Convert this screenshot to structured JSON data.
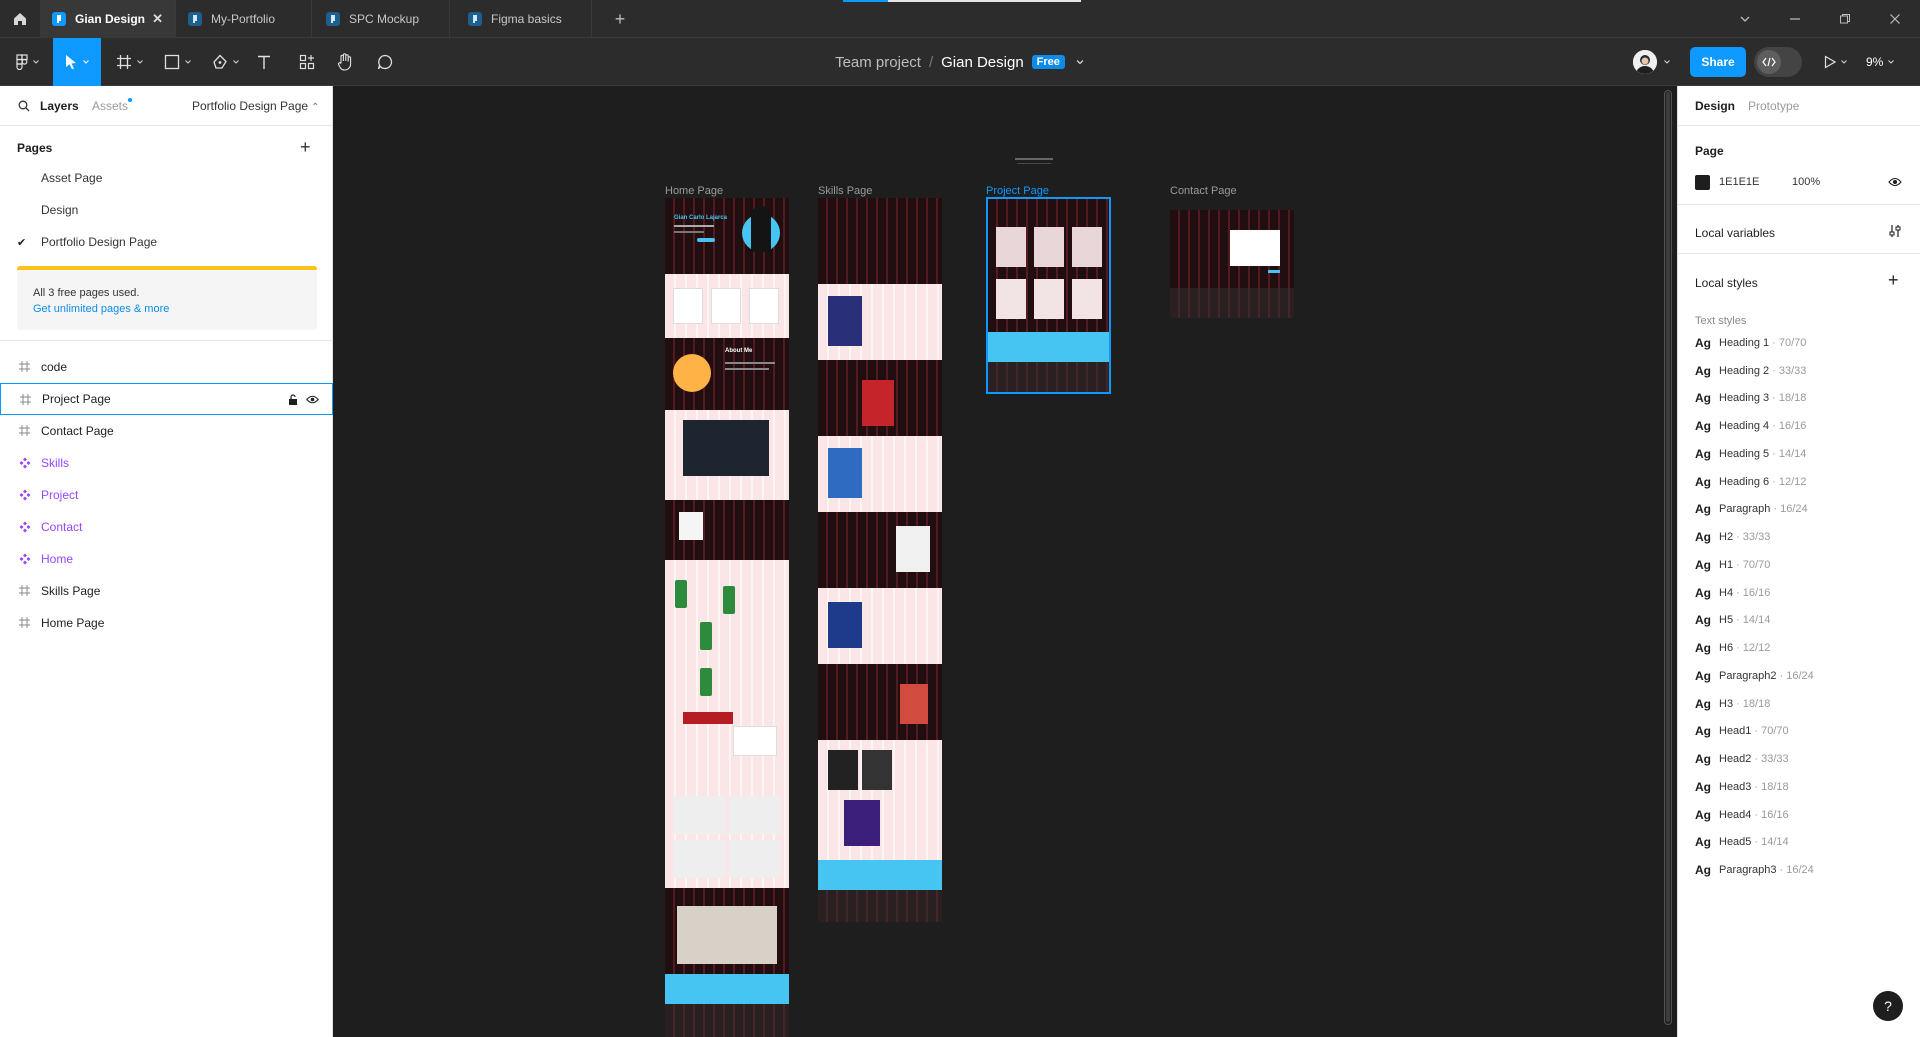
{
  "titlebar": {
    "tabs": [
      {
        "label": "Gian Design",
        "active": true
      },
      {
        "label": "My-Portfolio",
        "active": false
      },
      {
        "label": "SPC Mockup",
        "active": false
      },
      {
        "label": "Figma basics",
        "active": false
      }
    ],
    "close_glyph": "✕",
    "add_glyph": "+"
  },
  "toolbar": {
    "project": "Team project",
    "separator": "/",
    "file": "Gian Design",
    "plan_badge": "Free",
    "share_label": "Share",
    "zoom": "9%"
  },
  "left_panel": {
    "tab_layers": "Layers",
    "tab_assets": "Assets",
    "current_page": "Portfolio Design Page",
    "pages_header": "Pages",
    "add_glyph": "+",
    "check_glyph": "✔",
    "pages": [
      {
        "name": "Asset Page",
        "current": false
      },
      {
        "name": "Design",
        "current": false
      },
      {
        "name": "Portfolio Design Page",
        "current": true
      }
    ],
    "pages_warning": {
      "text": "All 3 free pages used.",
      "link": "Get unlimited pages & more"
    },
    "layers": [
      {
        "name": "code",
        "type": "frame",
        "selected": false
      },
      {
        "name": "Project Page",
        "type": "frame",
        "selected": true
      },
      {
        "name": "Contact Page",
        "type": "frame",
        "selected": false
      },
      {
        "name": "Skills",
        "type": "component",
        "selected": false
      },
      {
        "name": "Project",
        "type": "component",
        "selected": false
      },
      {
        "name": "Contact",
        "type": "component",
        "selected": false
      },
      {
        "name": "Home",
        "type": "component",
        "selected": false
      },
      {
        "name": "Skills Page",
        "type": "frame",
        "selected": false
      },
      {
        "name": "Home Page",
        "type": "frame",
        "selected": false
      }
    ]
  },
  "canvas": {
    "background": "#1E1E1E",
    "frames": [
      {
        "label": "Home Page",
        "selected": false
      },
      {
        "label": "Skills Page",
        "selected": false
      },
      {
        "label": "Project Page",
        "selected": true
      },
      {
        "label": "Contact Page",
        "selected": false
      }
    ],
    "home_texts": {
      "hero_name": "Gian Carlo Lajarca",
      "about": "About Me"
    }
  },
  "right_panel": {
    "tab_design": "Design",
    "tab_prototype": "Prototype",
    "page_header": "Page",
    "page_color": "1E1E1E",
    "page_opacity": "100%",
    "local_variables": "Local variables",
    "local_styles": "Local styles",
    "add_glyph": "+",
    "text_styles_label": "Text styles",
    "text_styles": [
      {
        "ag": "Ag",
        "name": "Heading 1",
        "size": "· 70/70"
      },
      {
        "ag": "Ag",
        "name": "Heading 2",
        "size": "· 33/33"
      },
      {
        "ag": "Ag",
        "name": "Heading 3",
        "size": "· 18/18"
      },
      {
        "ag": "Ag",
        "name": "Heading 4",
        "size": "· 16/16"
      },
      {
        "ag": "Ag",
        "name": "Heading 5",
        "size": "· 14/14"
      },
      {
        "ag": "Ag",
        "name": "Heading 6",
        "size": "· 12/12"
      },
      {
        "ag": "Ag",
        "name": "Paragraph",
        "size": "· 16/24"
      },
      {
        "ag": "Ag",
        "name": "H2",
        "size": "· 33/33"
      },
      {
        "ag": "Ag",
        "name": "H1",
        "size": "· 70/70"
      },
      {
        "ag": "Ag",
        "name": "H4",
        "size": "· 16/16"
      },
      {
        "ag": "Ag",
        "name": "H5",
        "size": "· 14/14"
      },
      {
        "ag": "Ag",
        "name": "H6",
        "size": "· 12/12"
      },
      {
        "ag": "Ag",
        "name": "Paragraph2",
        "size": "· 16/24"
      },
      {
        "ag": "Ag",
        "name": "H3",
        "size": "· 18/18"
      },
      {
        "ag": "Ag",
        "name": "Head1",
        "size": "· 70/70"
      },
      {
        "ag": "Ag",
        "name": "Head2",
        "size": "· 33/33"
      },
      {
        "ag": "Ag",
        "name": "Head3",
        "size": "· 18/18"
      },
      {
        "ag": "Ag",
        "name": "Head4",
        "size": "· 16/16"
      },
      {
        "ag": "Ag",
        "name": "Head5",
        "size": "· 14/14"
      },
      {
        "ag": "Ag",
        "name": "Paragraph3",
        "size": "· 16/24"
      }
    ],
    "help_glyph": "?"
  },
  "colors": {
    "accent": "#0D99FF",
    "component": "#9747FF",
    "warning": "#FFC21A",
    "chrome": "#2C2C2C"
  },
  "icons": [
    "home-icon",
    "figma-file-icon",
    "figma-menu-icon",
    "move-tool-icon",
    "frame-tool-icon",
    "shape-tool-icon",
    "pen-tool-icon",
    "text-tool-icon",
    "resources-icon",
    "hand-tool-icon",
    "comment-icon",
    "present-icon",
    "code-icon",
    "search-icon",
    "lock-icon",
    "eye-icon",
    "adjust-icon",
    "help-icon"
  ]
}
